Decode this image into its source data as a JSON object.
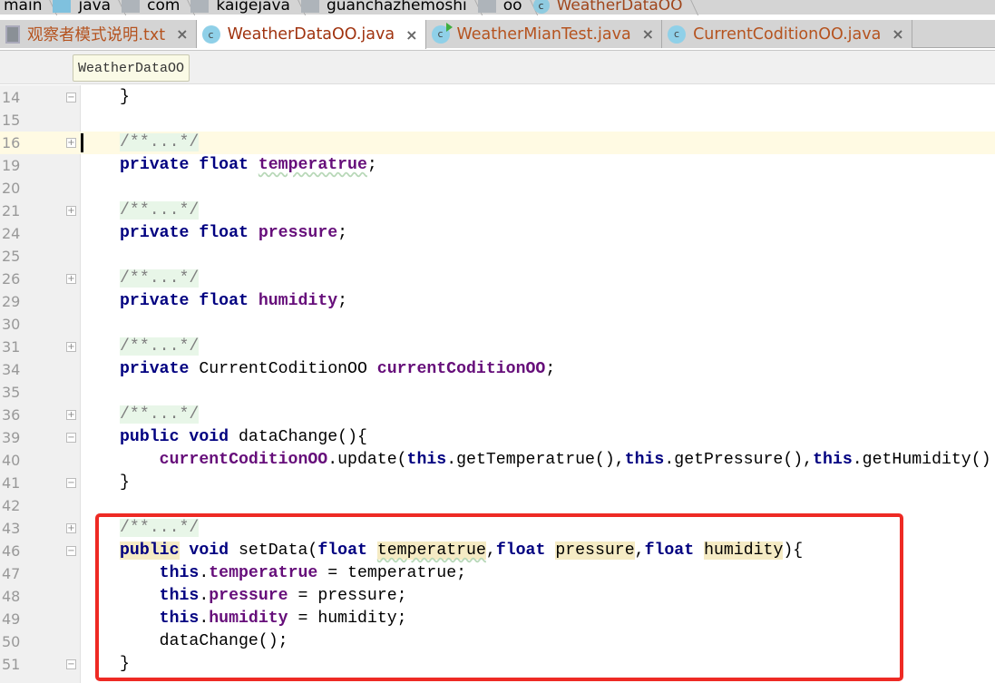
{
  "breadcrumbs": [
    {
      "label": "main",
      "icon": "none"
    },
    {
      "label": "java",
      "icon": "folder-java-icon"
    },
    {
      "label": "com",
      "icon": "package-icon"
    },
    {
      "label": "kaigejava",
      "icon": "package-icon"
    },
    {
      "label": "guanchazhemoshi",
      "icon": "package-icon"
    },
    {
      "label": "oo",
      "icon": "package-icon"
    },
    {
      "label": "WeatherDataOO",
      "icon": "class-icon"
    }
  ],
  "tabs": [
    {
      "label": "观察者模式说明.txt",
      "icon": "text-file-icon",
      "close": "×"
    },
    {
      "label": "WeatherDataOO.java",
      "icon": "class-icon",
      "close": "×",
      "active": true
    },
    {
      "label": "WeatherMianTest.java",
      "icon": "runnable-class-icon",
      "close": "×"
    },
    {
      "label": "CurrentCoditionOO.java",
      "icon": "class-icon",
      "close": "×"
    }
  ],
  "tooltip": "WeatherDataOO",
  "class_icon_letter": "c",
  "lines": [
    {
      "n": "14",
      "fold": "end",
      "tokens": [
        [
          "}",
          ""
        ]
      ]
    },
    {
      "n": "15",
      "tokens": []
    },
    {
      "n": "16",
      "fold": "plus",
      "cur": true,
      "tokens": [
        [
          "/**...*/",
          "cm"
        ]
      ]
    },
    {
      "n": "19",
      "tokens": [
        [
          "private",
          "kw"
        ],
        [
          " ",
          ""
        ],
        [
          "float",
          "kw"
        ],
        [
          " ",
          ""
        ],
        [
          "temperatrue",
          "fld ul"
        ],
        [
          ";",
          ""
        ]
      ]
    },
    {
      "n": "20",
      "tokens": []
    },
    {
      "n": "21",
      "fold": "plus",
      "tokens": [
        [
          "/**...*/",
          "cm"
        ]
      ]
    },
    {
      "n": "24",
      "tokens": [
        [
          "private",
          "kw"
        ],
        [
          " ",
          ""
        ],
        [
          "float",
          "kw"
        ],
        [
          " ",
          ""
        ],
        [
          "pressure",
          "fld"
        ],
        [
          ";",
          ""
        ]
      ]
    },
    {
      "n": "25",
      "tokens": []
    },
    {
      "n": "26",
      "fold": "plus",
      "tokens": [
        [
          "/**...*/",
          "cm"
        ]
      ]
    },
    {
      "n": "29",
      "tokens": [
        [
          "private",
          "kw"
        ],
        [
          " ",
          ""
        ],
        [
          "float",
          "kw"
        ],
        [
          " ",
          ""
        ],
        [
          "humidity",
          "fld"
        ],
        [
          ";",
          ""
        ]
      ]
    },
    {
      "n": "30",
      "tokens": []
    },
    {
      "n": "31",
      "fold": "plus",
      "tokens": [
        [
          "/**...*/",
          "cm"
        ]
      ]
    },
    {
      "n": "34",
      "tokens": [
        [
          "private",
          "kw"
        ],
        [
          " CurrentCoditionOO ",
          ""
        ],
        [
          "currentCoditionOO",
          "fld"
        ],
        [
          ";",
          ""
        ]
      ]
    },
    {
      "n": "35",
      "tokens": []
    },
    {
      "n": "36",
      "fold": "plus",
      "tokens": [
        [
          "/**...*/",
          "cm"
        ]
      ]
    },
    {
      "n": "39",
      "fold": "start",
      "tokens": [
        [
          "public",
          "kw"
        ],
        [
          " ",
          ""
        ],
        [
          "void",
          "kw"
        ],
        [
          " dataChange(){",
          ""
        ]
      ]
    },
    {
      "n": "40",
      "tokens": [
        [
          "    ",
          ""
        ],
        [
          "currentCoditionOO",
          "fld"
        ],
        [
          ".update(",
          ""
        ],
        [
          "this",
          "kw"
        ],
        [
          ".getTemperatrue(),",
          ""
        ],
        [
          "this",
          "kw"
        ],
        [
          ".getPressure(),",
          ""
        ],
        [
          "this",
          "kw"
        ],
        [
          ".getHumidity()",
          ""
        ]
      ]
    },
    {
      "n": "41",
      "fold": "end",
      "tokens": [
        [
          "}",
          ""
        ]
      ]
    },
    {
      "n": "42",
      "tokens": []
    },
    {
      "n": "43",
      "fold": "plus",
      "tokens": [
        [
          "/**...*/",
          "cm"
        ]
      ]
    },
    {
      "n": "46",
      "fold": "start",
      "tokens": [
        [
          "public",
          "kw hl"
        ],
        [
          " ",
          ""
        ],
        [
          "void",
          "kw"
        ],
        [
          " setData(",
          ""
        ],
        [
          "float",
          "kw"
        ],
        [
          " ",
          ""
        ],
        [
          "temperatrue",
          "hl ul"
        ],
        [
          ",",
          ""
        ],
        [
          "float",
          "kw"
        ],
        [
          " ",
          ""
        ],
        [
          "pressure",
          "hl"
        ],
        [
          ",",
          ""
        ],
        [
          "float",
          "kw"
        ],
        [
          " ",
          ""
        ],
        [
          "humidity",
          "hl"
        ],
        [
          "){",
          ""
        ]
      ]
    },
    {
      "n": "47",
      "tokens": [
        [
          "    ",
          ""
        ],
        [
          "this",
          "kw"
        ],
        [
          ".",
          ""
        ],
        [
          "temperatrue",
          "fld"
        ],
        [
          " = temperatrue;",
          ""
        ]
      ]
    },
    {
      "n": "48",
      "tokens": [
        [
          "    ",
          ""
        ],
        [
          "this",
          "kw"
        ],
        [
          ".",
          ""
        ],
        [
          "pressure",
          "fld"
        ],
        [
          " = pressure;",
          ""
        ]
      ]
    },
    {
      "n": "49",
      "tokens": [
        [
          "    ",
          ""
        ],
        [
          "this",
          "kw"
        ],
        [
          ".",
          ""
        ],
        [
          "humidity",
          "fld"
        ],
        [
          " = humidity;",
          ""
        ]
      ]
    },
    {
      "n": "50",
      "tokens": [
        [
          "    dataChange();",
          ""
        ]
      ]
    },
    {
      "n": "51",
      "fold": "end",
      "tokens": [
        [
          "}",
          ""
        ]
      ]
    }
  ]
}
